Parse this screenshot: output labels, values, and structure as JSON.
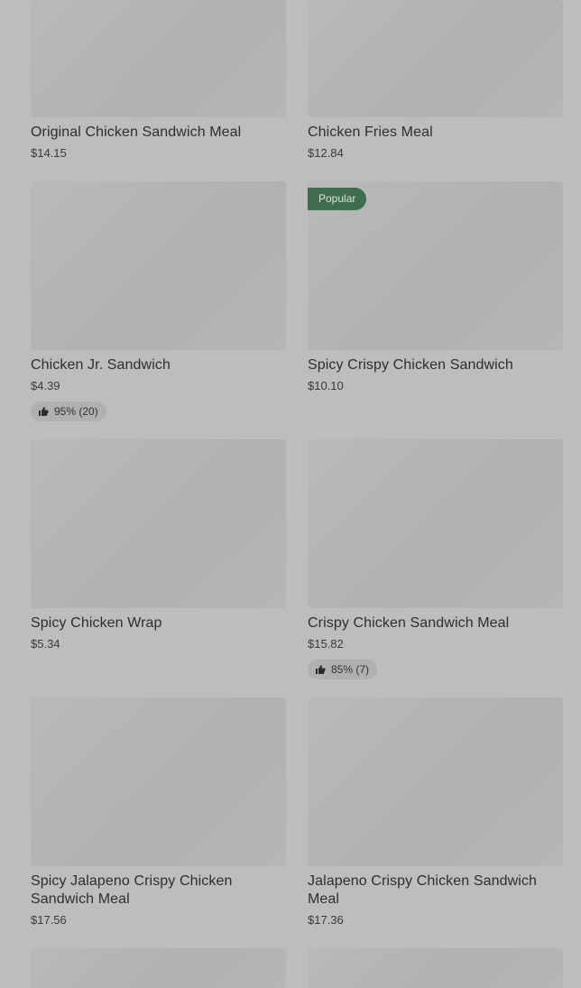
{
  "menu_items": [
    {
      "name": "Original Chicken Sandwich Meal",
      "price": "$14.15"
    },
    {
      "name": "Chicken Fries Meal",
      "price": "$12.84"
    },
    {
      "name": "Chicken Jr. Sandwich",
      "price": "$4.39",
      "rating": "95% (20)"
    },
    {
      "name": "Spicy Crispy Chicken Sandwich",
      "price": "$10.10",
      "badge": "Popular"
    },
    {
      "name": "Spicy Chicken Wrap",
      "price": "$5.34"
    },
    {
      "name": "Crispy Chicken Sandwich Meal",
      "price": "$15.82",
      "rating": "85% (7)"
    },
    {
      "name": "Spicy Jalapeno Crispy Chicken Sandwich Meal",
      "price": "$17.56"
    },
    {
      "name": "Jalapeno Crispy Chicken Sandwich Meal",
      "price": "$17.36"
    }
  ],
  "icons": {
    "rating": "thumbs-up-icon"
  },
  "colors": {
    "background": "#bdbdbd",
    "badge": "#3f6d4e",
    "rating_pill": "#b0b0b0"
  }
}
